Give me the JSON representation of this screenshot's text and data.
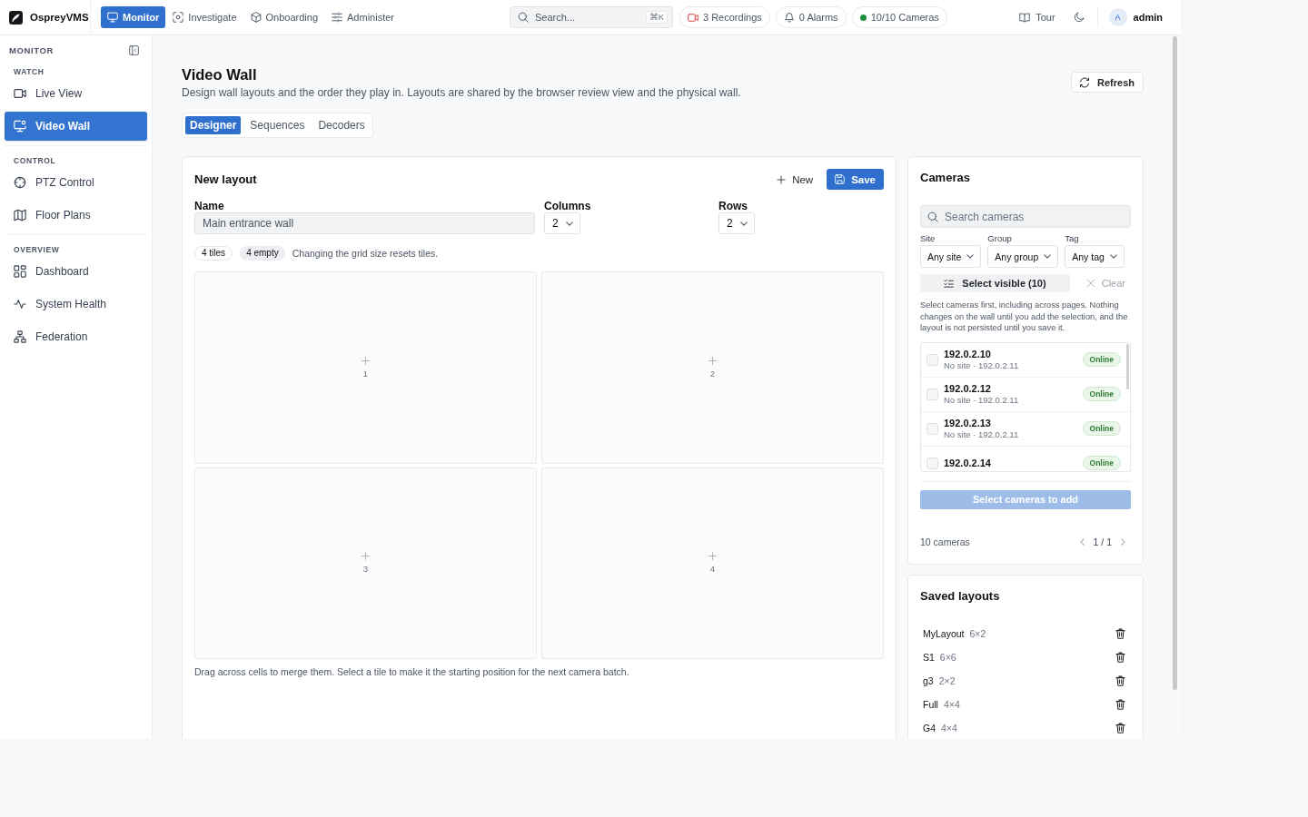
{
  "topbar": {
    "brand": "OspreyVMS",
    "nav": [
      {
        "label": "Monitor",
        "kind": "monitor",
        "selected": true
      },
      {
        "label": "Investigate",
        "kind": "investigate",
        "selected": false
      },
      {
        "label": "Onboarding",
        "kind": "onboarding",
        "selected": false
      },
      {
        "label": "Administer",
        "kind": "administer",
        "selected": false
      }
    ],
    "search": {
      "placeholder": "Search...",
      "shortcut": "⌘K"
    },
    "pills": [
      {
        "label": "3 Recordings",
        "kind": "recordings"
      },
      {
        "label": "0 Alarms",
        "kind": "alarms"
      },
      {
        "label": "10/10 Cameras",
        "kind": "cameras"
      }
    ],
    "tour": "Tour",
    "user": {
      "initial": "A",
      "name": "admin"
    }
  },
  "sidebar": {
    "title": "MONITOR",
    "sections": [
      {
        "heading": "WATCH",
        "items": [
          {
            "label": "Live View",
            "kind": "live",
            "selected": false
          },
          {
            "label": "Video Wall",
            "kind": "wall",
            "selected": true
          }
        ]
      },
      {
        "heading": "CONTROL",
        "items": [
          {
            "label": "PTZ Control",
            "kind": "ptz",
            "selected": false
          },
          {
            "label": "Floor Plans",
            "kind": "floor",
            "selected": false
          }
        ]
      },
      {
        "heading": "OVERVIEW",
        "items": [
          {
            "label": "Dashboard",
            "kind": "dashboard",
            "selected": false
          },
          {
            "label": "System Health",
            "kind": "health",
            "selected": false
          },
          {
            "label": "Federation",
            "kind": "federation",
            "selected": false
          }
        ]
      }
    ]
  },
  "page": {
    "title": "Video Wall",
    "subtitle": "Design wall layouts and the order they play in. Layouts are shared by the browser review view and the physical wall.",
    "refresh": "Refresh",
    "tabs": [
      {
        "label": "Designer",
        "selected": true
      },
      {
        "label": "Sequences",
        "selected": false
      },
      {
        "label": "Decoders",
        "selected": false
      }
    ]
  },
  "layout": {
    "title": "New layout",
    "new": "New",
    "save": "Save",
    "name": {
      "label": "Name",
      "value": "Main entrance wall"
    },
    "columns": {
      "label": "Columns",
      "value": "2"
    },
    "rows": {
      "label": "Rows",
      "value": "2"
    },
    "chips": [
      {
        "label": "4 tiles",
        "kind": "count"
      },
      {
        "label": "4 empty",
        "kind": "empty"
      }
    ],
    "note": "Changing the grid size resets tiles.",
    "tiles": [
      {
        "label": "1"
      },
      {
        "label": "2"
      },
      {
        "label": "3"
      },
      {
        "label": "4"
      }
    ],
    "hint": "Drag across cells to merge them. Select a tile to make it the starting position for the next camera batch."
  },
  "cameras": {
    "title": "Cameras",
    "search": {
      "placeholder": "Search cameras"
    },
    "filters": [
      {
        "label": "Site",
        "value": "Any site"
      },
      {
        "label": "Group",
        "value": "Any group"
      },
      {
        "label": "Tag",
        "value": "Any tag"
      }
    ],
    "select_visible": "Select visible (10)",
    "clear": "Clear",
    "help": "Select cameras first, including across pages. Nothing changes on the wall until you add the selection, and the layout is not persisted until you save it.",
    "list": [
      {
        "name": "192.0.2.10",
        "detail": "No site · 192.0.2.11",
        "status": "Online",
        "checked": false
      },
      {
        "name": "192.0.2.12",
        "detail": "No site · 192.0.2.11",
        "status": "Online",
        "checked": false
      },
      {
        "name": "192.0.2.13",
        "detail": "No site · 192.0.2.11",
        "status": "Online",
        "checked": false
      },
      {
        "name": "192.0.2.14",
        "status": "Online",
        "checked": false
      }
    ],
    "add_button": {
      "label": "Select cameras to add",
      "disabled": true
    },
    "count": "10 cameras",
    "pager": "1 / 1"
  },
  "saved_layouts": {
    "title": "Saved layouts",
    "items": [
      {
        "name": "MyLayout",
        "size": "6×2"
      },
      {
        "name": "S1",
        "size": "6×6"
      },
      {
        "name": "g3",
        "size": "2×2"
      },
      {
        "name": "Full",
        "size": "4×4"
      },
      {
        "name": "G4",
        "size": "4×4"
      }
    ]
  }
}
